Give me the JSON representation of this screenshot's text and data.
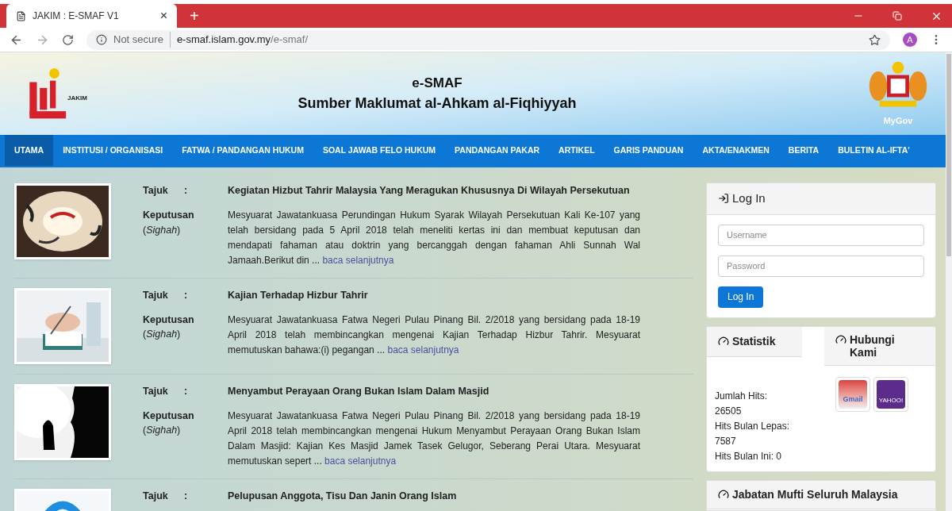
{
  "browser": {
    "tab": {
      "title": "JAKIM : E-SMAF V1",
      "close": "×"
    },
    "new_tab": "+",
    "security": "Not secure",
    "url_host": "e-smaf.islam.gov.my",
    "url_path": "/e-smaf/",
    "avatar": "A"
  },
  "header": {
    "logo_text": "JAKIM",
    "title": "e-SMAF",
    "subtitle": "Sumber Maklumat al-Ahkam al-Fiqhiyyah",
    "emblem_text": "MyGov"
  },
  "nav": [
    {
      "label": "UTAMA",
      "selected": true
    },
    {
      "label": "INSTITUSI / ORGANISASI",
      "selected": false
    },
    {
      "label": "FATWA / PANDANGAN HUKUM",
      "selected": false
    },
    {
      "label": "SOAL JAWAB FELO HUKUM",
      "selected": false
    },
    {
      "label": "PANDANGAN PAKAR",
      "selected": false
    },
    {
      "label": "ARTIKEL",
      "selected": false
    },
    {
      "label": "GARIS PANDUAN",
      "selected": false
    },
    {
      "label": "AKTA/ENAKMEN",
      "selected": false
    },
    {
      "label": "BERITA",
      "selected": false
    },
    {
      "label": "BULETIN AL-IFTA'",
      "selected": false
    }
  ],
  "articles": [
    {
      "title_label": "Tajuk",
      "colon": ":",
      "title": "Kegiatan Hizbut Tahrir Malaysia Yang Meragukan Khususnya Di Wilayah Persekutuan",
      "decision_label": "Keputusan",
      "decision_sub": "(*Sighah*)",
      "body": "Mesyuarat Jawatankuasa Perundingan Hukum Syarak Wilayah Persekutuan Kali Ke-107 yang telah bersidang pada 5 April 2018 telah meneliti kertas ini dan membuat keputusan dan mendapati fahaman atau doktrin yang bercanggah dengan fahaman Ahli Sunnah Wal Jamaah.Berikut din ...",
      "link": "baca selanjutnya"
    },
    {
      "title_label": "Tajuk",
      "colon": ":",
      "title": "Kajian Terhadap Hizbur Tahrir",
      "decision_label": "Keputusan",
      "decision_sub": "(*Sighah*)",
      "body": "Mesyuarat Jawatankuasa Fatwa Negeri Pulau Pinang Bil. 2/2018 yang bersidang pada 18-19 April 2018 telah membincangkan mengenai Kajian Terhadap Hizbur Tahrir. Mesyuarat memutuskan bahawa:(i) pegangan ...",
      "link": "baca selanjutnya"
    },
    {
      "title_label": "Tajuk",
      "colon": ":",
      "title": "Menyambut Perayaan Orang Bukan Islam Dalam Masjid",
      "decision_label": "Keputusan",
      "decision_sub": "(*Sighah*)",
      "body": "Mesyuarat Jawatankuasa Fatwa Negeri Pulau Pinang Bil. 2/2018 yang bersidang pada 18-19 April 2018 telah membincangkan mengenai Hukum Menyambut Perayaan Orang Bukan Islam Dalam Masjid: Kajian Kes Masjid Jamek Tasek Gelugor, Seberang Perai Utara. Mesyuarat memutuskan sepert ...",
      "link": "baca selanjutnya"
    },
    {
      "title_label": "Tajuk",
      "colon": ":",
      "title": "Pelupusan Anggota, Tisu Dan Janin Orang Islam"
    }
  ],
  "login": {
    "title": "Log In",
    "username_placeholder": "Username",
    "password_placeholder": "Password",
    "button": "Log In"
  },
  "stats": {
    "title": "Statistik",
    "lines": [
      "Jumlah Hits:",
      "26505",
      "Hits Bulan Lepas:",
      "7587",
      "Hits Bulan Ini: 0"
    ]
  },
  "contact": {
    "title": "Hubungi Kami",
    "mail_label": "Gmail",
    "yahoo_label": "YAHOO!"
  },
  "mufti": {
    "title": "Jabatan Mufti Seluruh Malaysia"
  }
}
